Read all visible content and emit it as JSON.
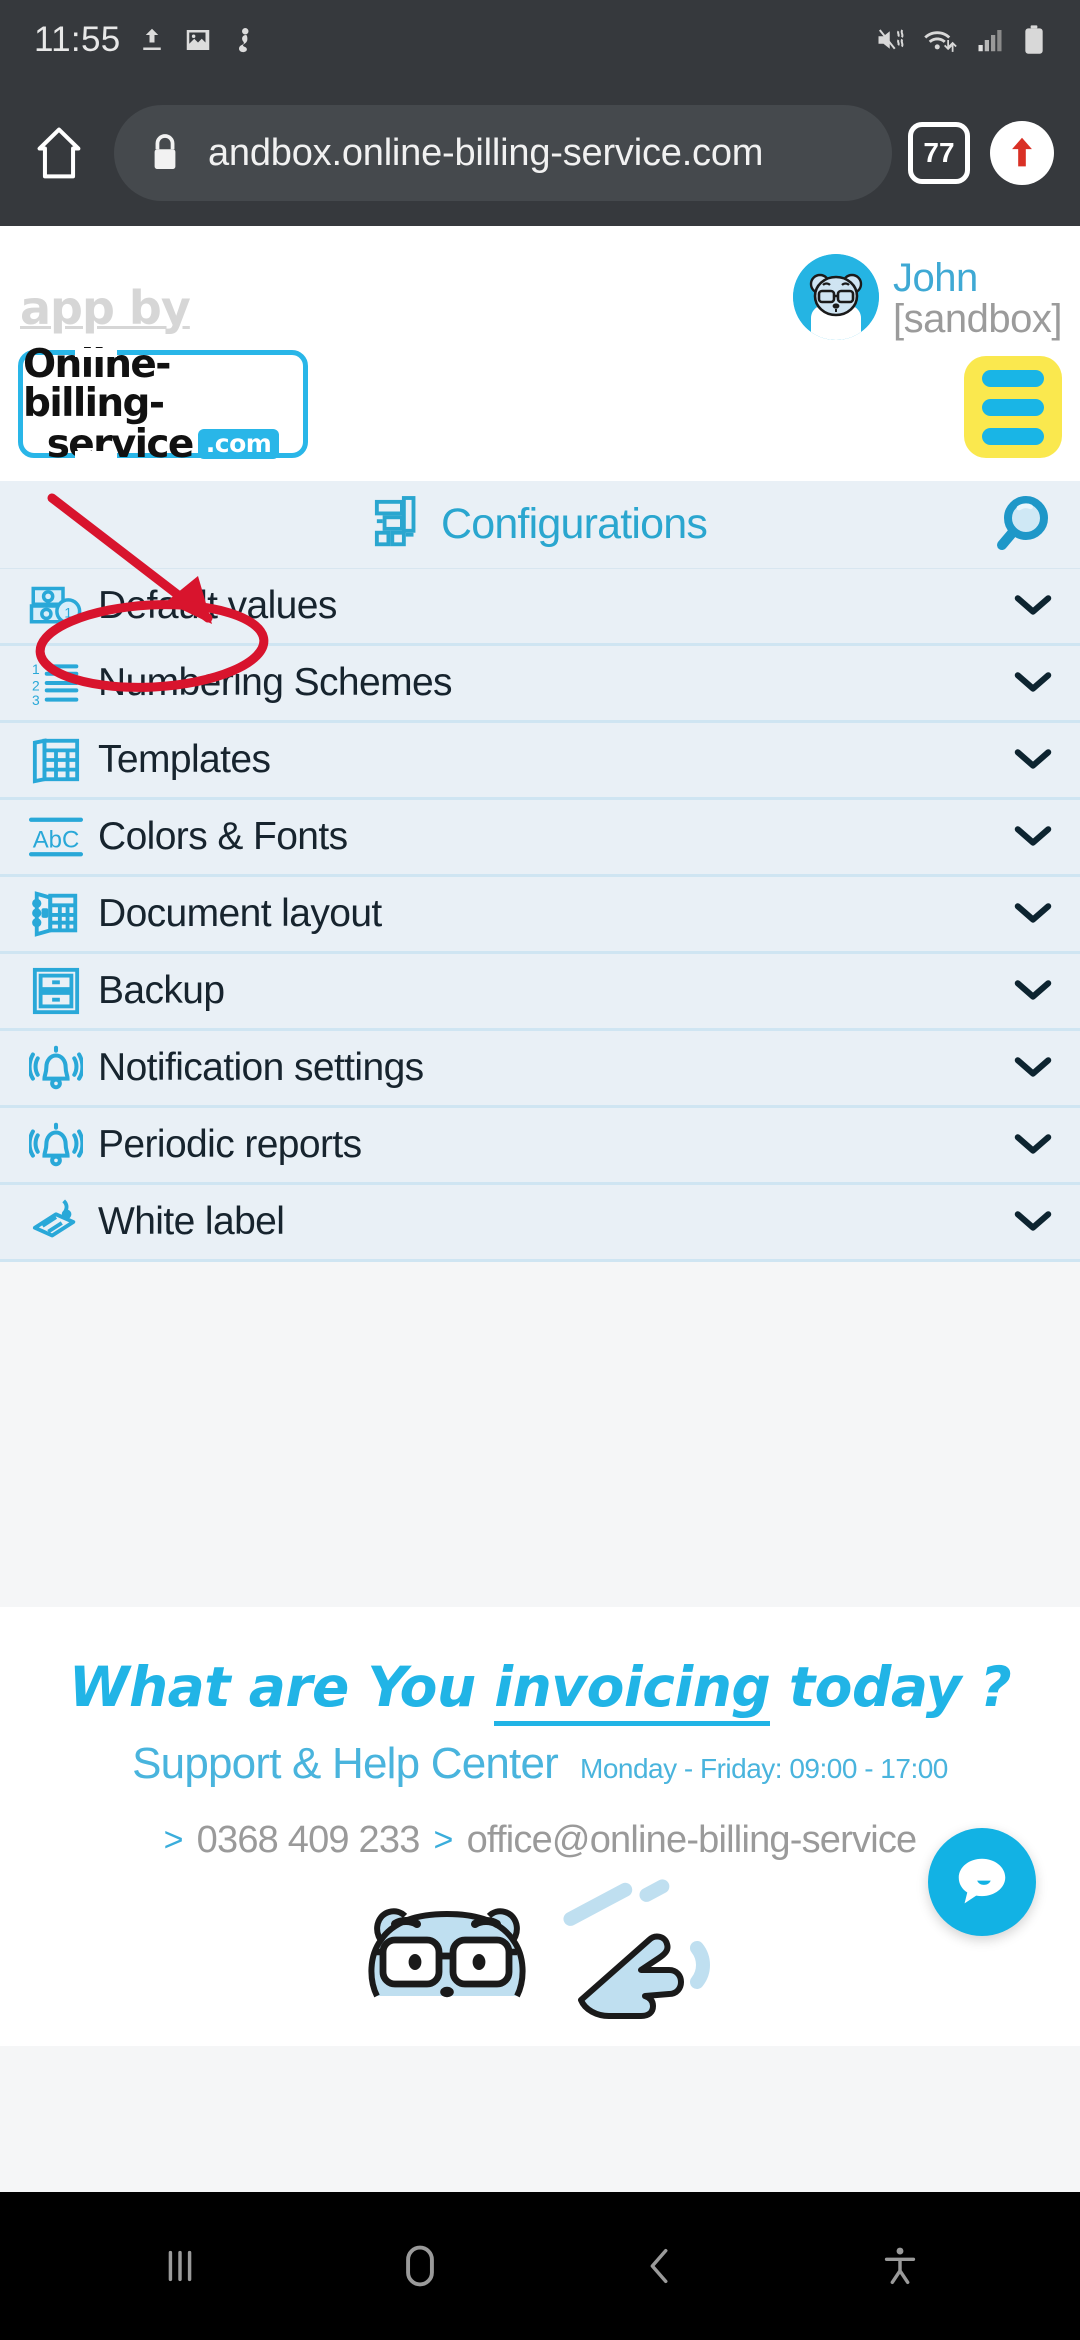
{
  "status_bar": {
    "time": "11:55",
    "icons_left": [
      "upload-icon",
      "image-icon",
      "download-manager-icon"
    ],
    "icons_right": [
      "mute-vibrate-icon",
      "wifi-icon",
      "signal-icon",
      "battery-icon"
    ]
  },
  "browser": {
    "home_label": "home-icon",
    "url": "andbox.online-billing-service.com",
    "secure_icon": "lock-icon",
    "tab_count": "77",
    "upload_icon": "upload-arrow-icon"
  },
  "site_header": {
    "app_by": "app by",
    "user_name": "John",
    "user_env": "[sandbox]",
    "logo_line1": "Online-billing-",
    "logo_line2": "service",
    "logo_badge": ".com",
    "menu_label": "menu-icon"
  },
  "config": {
    "title": "Configurations",
    "search_label": "search-icon",
    "items": [
      {
        "label": "Default values",
        "icon": "money-icon"
      },
      {
        "label": "Numbering Schemes",
        "icon": "numbered-list-icon"
      },
      {
        "label": "Templates",
        "icon": "templates-icon"
      },
      {
        "label": "Colors & Fonts",
        "icon": "abc-icon"
      },
      {
        "label": "Document layout",
        "icon": "document-layout-icon"
      },
      {
        "label": "Backup",
        "icon": "backup-icon"
      },
      {
        "label": "Notification settings",
        "icon": "bell-icon"
      },
      {
        "label": "Periodic reports",
        "icon": "bell-icon"
      },
      {
        "label": "White label",
        "icon": "tag-icon"
      }
    ]
  },
  "footer": {
    "question": "What are You invoicing today ?",
    "question_part1": "What are ",
    "question_part2": "You ",
    "question_underlined": "invoicing",
    "question_part3": " today ?",
    "support_title": "Support & Help Center",
    "hours": "Monday - Friday: 09:00 - 17:00",
    "phone": "0368 409 233",
    "email": "office@online-billing-service",
    "chevron": ">",
    "chat_label": "chat-bubble-icon"
  },
  "annotation": {
    "arrow": "red-arrow",
    "ellipse": "red-ellipse-highlight",
    "target": "Default values",
    "color": "#d8142d"
  },
  "nav_bar": {
    "recents": "recents-icon",
    "home": "home-icon",
    "back": "back-icon",
    "accessibility": "accessibility-icon"
  },
  "colors": {
    "accent_cyan": "#21b4e6",
    "menu_yellow": "#fae84e",
    "row_bg": "#e9f0f6",
    "row_divider": "#cfe5f2",
    "annotation_red": "#d8142d"
  }
}
